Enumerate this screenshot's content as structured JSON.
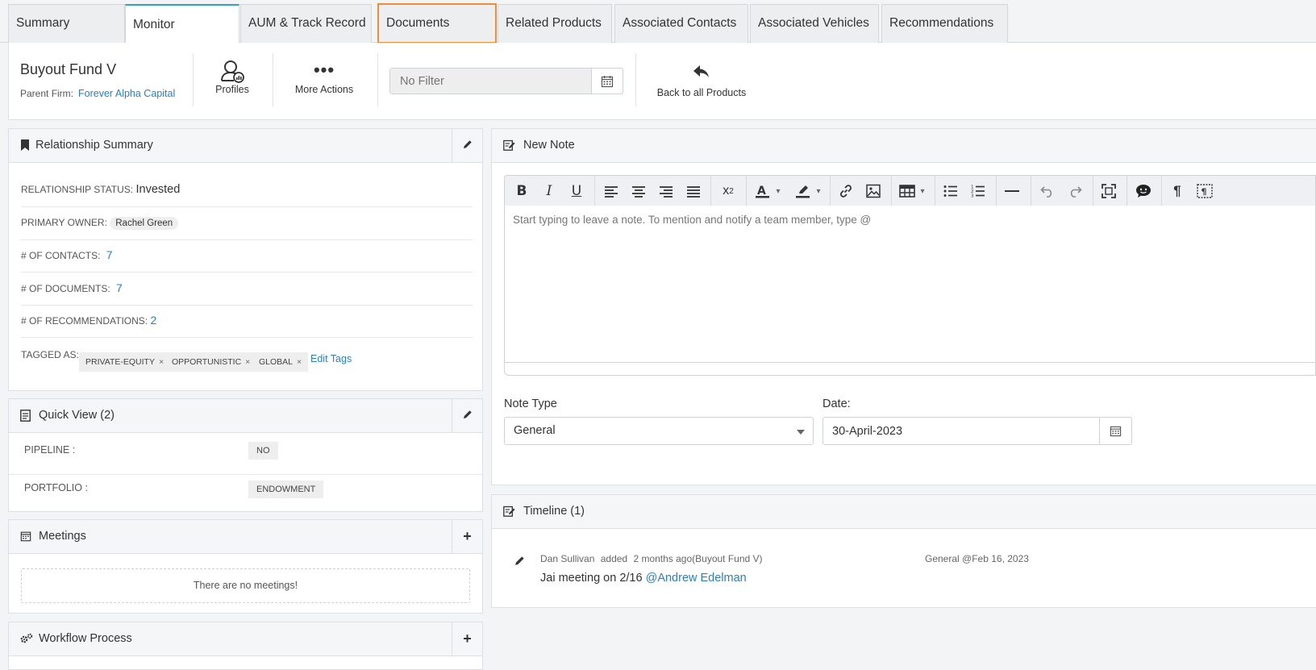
{
  "tabs": [
    {
      "label": "Summary",
      "active": false
    },
    {
      "label": "Monitor",
      "active": true
    },
    {
      "label": "AUM & Track Record",
      "active": false
    },
    {
      "label": "Documents",
      "active": false,
      "highlighted": true
    },
    {
      "label": "Related Products",
      "active": false
    },
    {
      "label": "Associated Contacts",
      "active": false
    },
    {
      "label": "Associated Vehicles",
      "active": false
    },
    {
      "label": "Recommendations",
      "active": false
    }
  ],
  "header": {
    "title": "Buyout Fund V",
    "parent_label": "Parent Firm:",
    "parent_firm": "Forever Alpha Capital",
    "profiles_label": "Profiles",
    "more_actions_label": "More Actions",
    "filter_placeholder": "No Filter",
    "back_label": "Back to all Products"
  },
  "relationship_summary": {
    "title": "Relationship Summary",
    "status_label": "RELATIONSHIP STATUS:",
    "status_value": "Invested",
    "owner_label": "PRIMARY OWNER:",
    "owner_value": "Rachel Green",
    "contacts_label": "# OF CONTACTS:",
    "contacts_value": "7",
    "documents_label": "# OF DOCUMENTS:",
    "documents_value": "7",
    "recommendations_label": "# OF RECOMMENDATIONS:",
    "recommendations_value": "2",
    "tagged_label": "TAGGED AS:",
    "tags": [
      "PRIVATE-EQUITY",
      "OPPORTUNISTIC",
      "GLOBAL"
    ],
    "edit_tags_label": "Edit Tags"
  },
  "quick_view": {
    "title": "Quick View (2)",
    "rows": [
      {
        "label": "PIPELINE :",
        "value": "NO"
      },
      {
        "label": "PORTFOLIO :",
        "value": "ENDOWMENT"
      }
    ]
  },
  "meetings": {
    "title": "Meetings",
    "empty_text": "There are no meetings!"
  },
  "workflow": {
    "title": "Workflow Process"
  },
  "new_note": {
    "title": "New Note",
    "editor_placeholder": "Start typing to leave a note. To mention and notify a team member, type @",
    "note_type_label": "Note Type",
    "note_type_value": "General",
    "date_label": "Date:",
    "date_value": "30-April-2023"
  },
  "timeline": {
    "title": "Timeline (1)",
    "entries": [
      {
        "author": "Dan Sullivan",
        "action": "added",
        "when": "2 months ago(Buyout Fund V)",
        "type_date": "General @Feb 16, 2023",
        "text": "Jai meeting on 2/16",
        "mention": "@Andrew Edelman"
      }
    ]
  },
  "colors": {
    "accent": "#2f9fd8",
    "link": "#2a7fc1",
    "highlight_outline": "#f08c3c"
  }
}
